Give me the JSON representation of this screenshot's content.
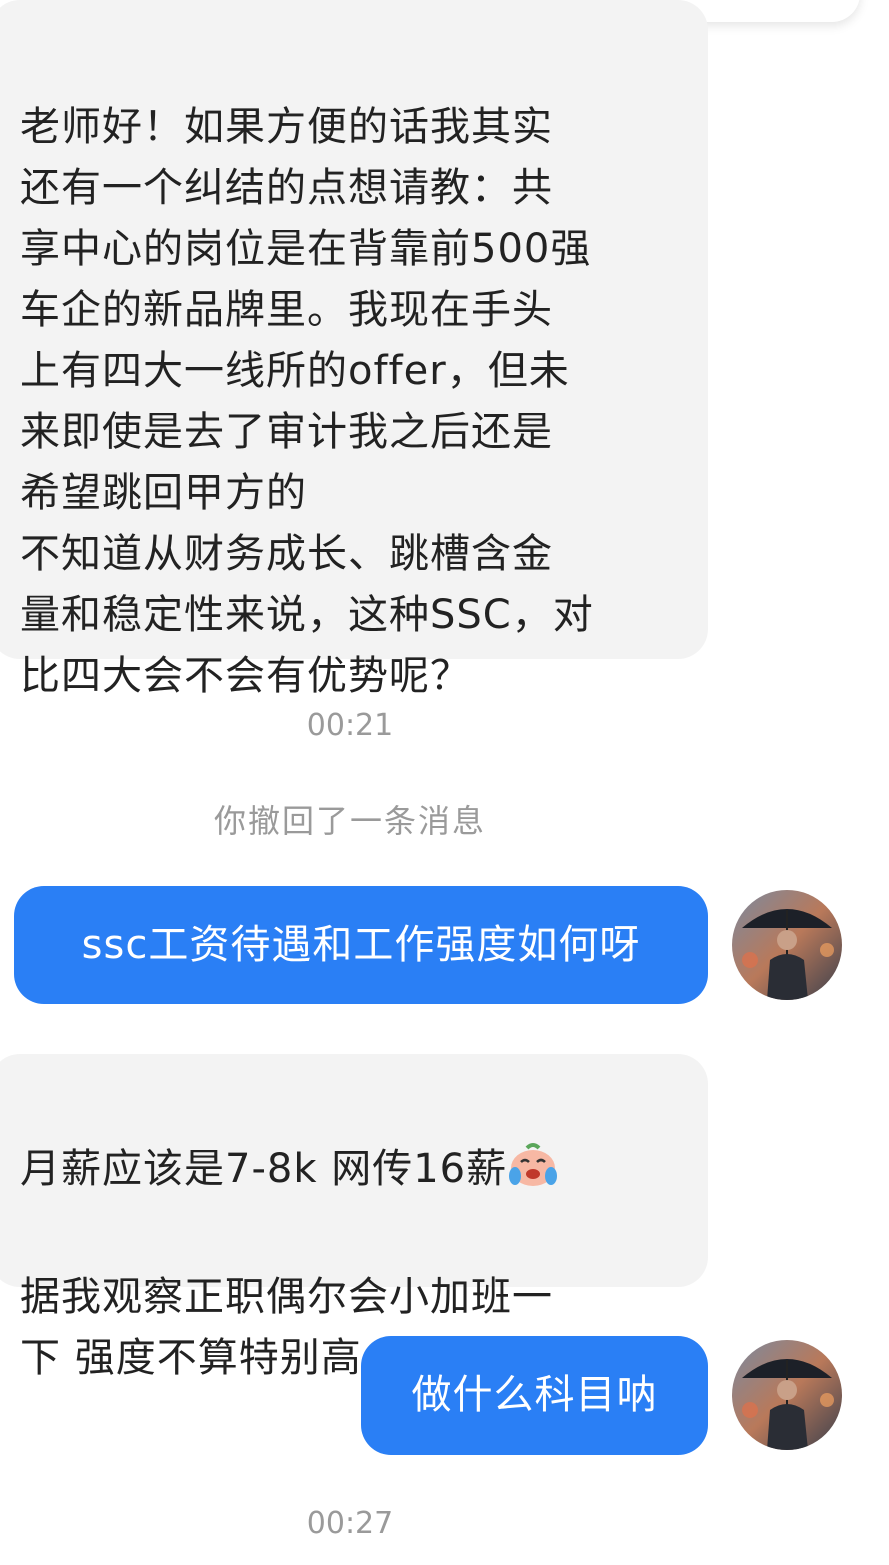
{
  "messages": {
    "m1": {
      "text": "老师好！如果方便的话我其实\n还有一个纠结的点想请教：共\n享中心的岗位是在背靠前500强\n车企的新品牌里。我现在手头\n上有四大一线所的offer，但未\n来即使是去了审计我之后还是\n希望跳回甲方的\n不知道从财务成长、跳槽含金\n量和稳定性来说，这种SSC，对\n比四大会不会有优势呢？"
    },
    "time1": "00:21",
    "recall_notice": "你撤回了一条消息",
    "m2": {
      "text": "ssc工资待遇和工作强度如何呀"
    },
    "m3": {
      "line1": "月薪应该是7-8k 网传16薪",
      "rest": "据我观察正职偶尔会小加班一\n下  强度不算特别高",
      "emoji": "crying-laughing-emoji"
    },
    "m4": {
      "text": "做什么科目呐"
    },
    "time2": "00:27"
  },
  "colors": {
    "outgoing_bubble": "#2a7ff5",
    "incoming_bubble": "#f3f3f3",
    "timestamp": "#9a9a9a"
  },
  "icons": {
    "avatar": "man-with-umbrella-avatar"
  }
}
